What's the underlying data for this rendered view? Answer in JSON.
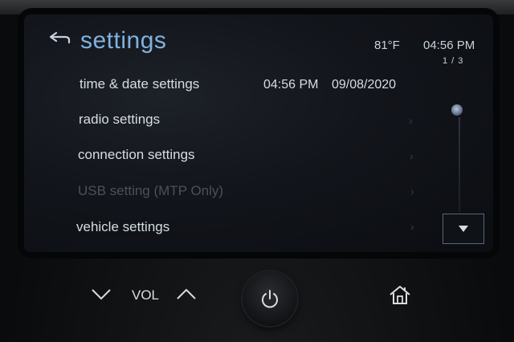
{
  "header": {
    "title": "settings",
    "temperature": "81°F",
    "time": "04:56 PM",
    "page_indicator": "1 / 3"
  },
  "menu": {
    "items": [
      {
        "label": "time & date settings",
        "time_value": "04:56 PM",
        "date_value": "09/08/2020",
        "enabled": true
      },
      {
        "label": "radio settings",
        "enabled": true
      },
      {
        "label": "connection settings",
        "enabled": true
      },
      {
        "label": "USB setting (MTP Only)",
        "enabled": false
      },
      {
        "label": "vehicle settings",
        "enabled": true
      }
    ]
  },
  "controls": {
    "vol_label": "VOL"
  },
  "icons": {
    "back": "back-arrow-icon",
    "scroll_down": "triangle-down-icon",
    "vol_down": "chevron-down-icon",
    "vol_up": "chevron-up-icon",
    "power": "power-icon",
    "home": "home-icon"
  },
  "colors": {
    "title": "#7fb2e0",
    "text": "#d7dde4",
    "disabled": "#4c5158",
    "screen_bg": "#12151b"
  }
}
